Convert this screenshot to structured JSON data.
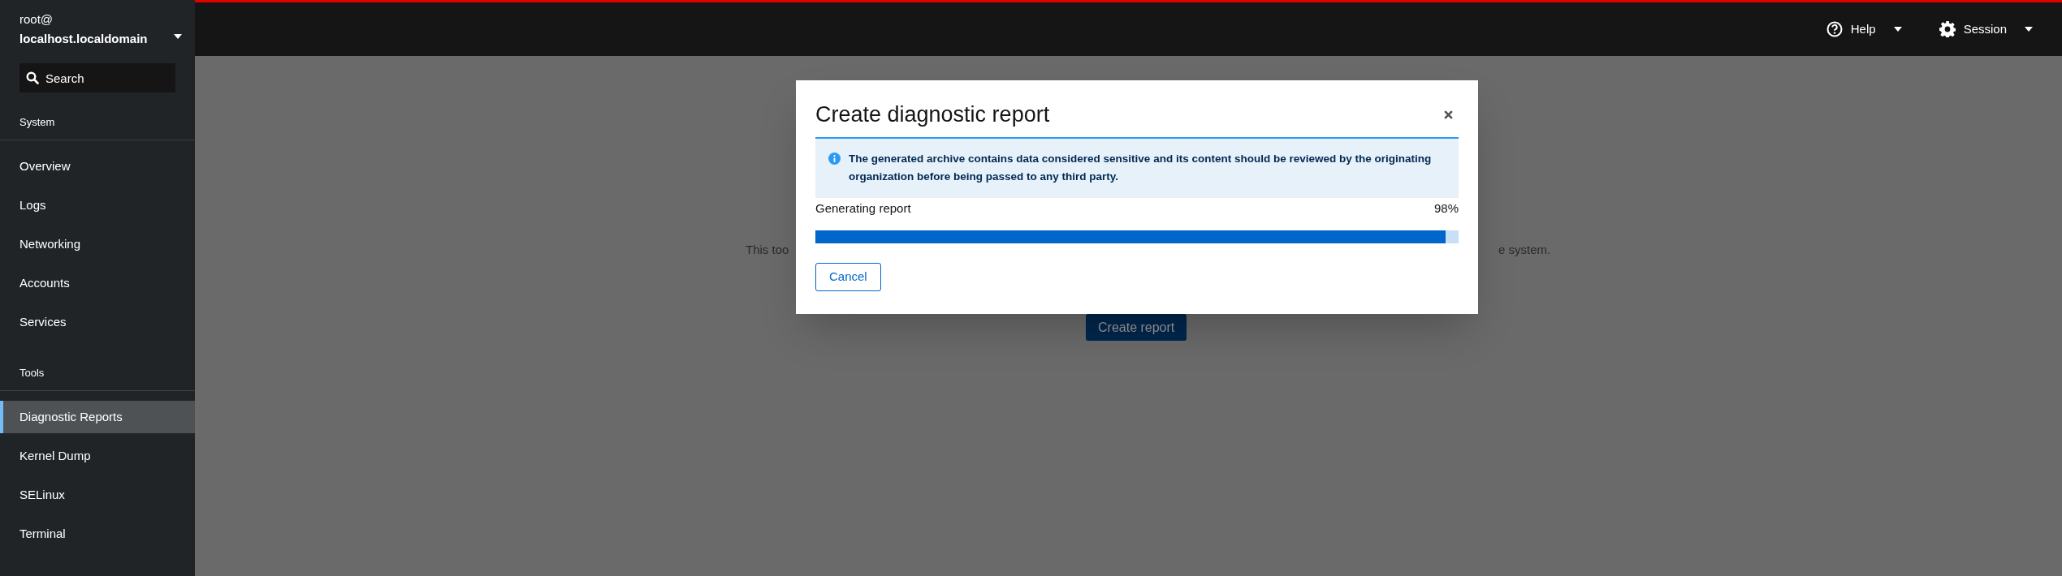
{
  "sidebar": {
    "user": "root@",
    "host": "localhost.localdomain",
    "search": {
      "placeholder": "Search"
    },
    "groups": [
      {
        "heading": "System",
        "items": [
          {
            "label": "Overview",
            "selected": false
          },
          {
            "label": "Logs",
            "selected": false
          },
          {
            "label": "Networking",
            "selected": false
          },
          {
            "label": "Accounts",
            "selected": false
          },
          {
            "label": "Services",
            "selected": false
          }
        ]
      },
      {
        "heading": "Tools",
        "items": [
          {
            "label": "Diagnostic Reports",
            "selected": true
          },
          {
            "label": "Kernel Dump",
            "selected": false
          },
          {
            "label": "SELinux",
            "selected": false
          },
          {
            "label": "Terminal",
            "selected": false
          }
        ]
      }
    ]
  },
  "header": {
    "menus": [
      {
        "kind": "help",
        "label": "Help"
      },
      {
        "kind": "session",
        "label": "Session"
      }
    ]
  },
  "page": {
    "text_left": "This too",
    "text_right": "e system.",
    "button": "Create report"
  },
  "dialog": {
    "title": "Create diagnostic report",
    "alert": "The generated archive contains data considered sensitive and its content should be reviewed by the originating organization before being passed to any third party.",
    "progress": {
      "label": "Generating report",
      "reading": "98%",
      "level": 0.98
    },
    "buttons": [
      "Cancel"
    ]
  }
}
